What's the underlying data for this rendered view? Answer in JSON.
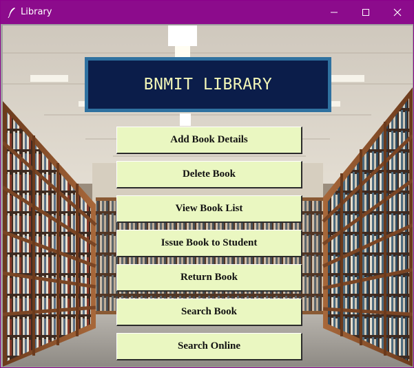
{
  "window": {
    "title": "Library",
    "icon": "feather-icon",
    "controls": [
      "minimize-icon",
      "maximize-icon",
      "close-icon"
    ]
  },
  "banner": {
    "title": "BNMIT LIBRARY"
  },
  "menu": [
    {
      "label": "Add Book Details"
    },
    {
      "label": "Delete Book"
    },
    {
      "label": "View Book List"
    },
    {
      "label": "Issue Book to Student"
    },
    {
      "label": "Return Book"
    },
    {
      "label": "Search Book"
    },
    {
      "label": "Search Online"
    }
  ],
  "colors": {
    "titlebar": "#8c0b8c",
    "banner_bg": "#0b1d4a",
    "banner_border": "#2f71a0",
    "banner_text": "#f3f7b8",
    "button_bg": "#eaf7c1"
  }
}
